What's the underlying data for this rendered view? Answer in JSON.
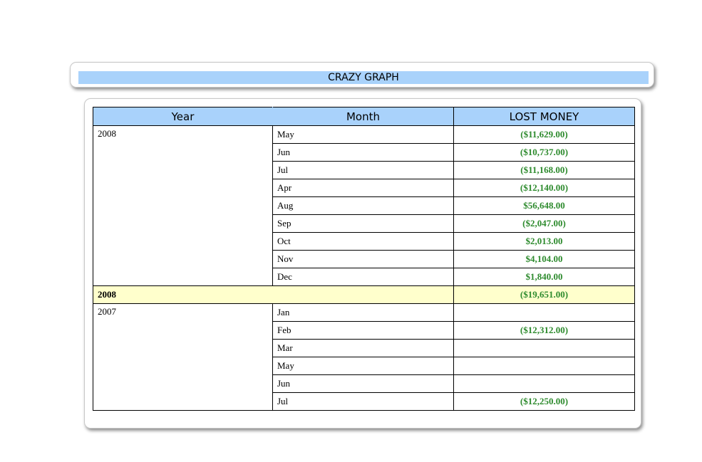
{
  "title": "CRAZY GRAPH",
  "headers": [
    "Year",
    "Month",
    "LOST MONEY"
  ],
  "groups": [
    {
      "year": "2008",
      "rows": [
        {
          "month": "May",
          "money": "($11,629.00)"
        },
        {
          "month": "Jun",
          "money": "($10,737.00)"
        },
        {
          "month": "Jul",
          "money": "($11,168.00)"
        },
        {
          "month": "Apr",
          "money": "($12,140.00)"
        },
        {
          "month": "Aug",
          "money": "$56,648.00"
        },
        {
          "month": "Sep",
          "money": "($2,047.00)"
        },
        {
          "month": "Oct",
          "money": "$2,013.00"
        },
        {
          "month": "Nov",
          "money": "$4,104.00"
        },
        {
          "month": "Dec",
          "money": "$1,840.00"
        }
      ],
      "total": {
        "label": "2008",
        "money": "($19,651.00)"
      }
    },
    {
      "year": "2007",
      "rows": [
        {
          "month": "Jan",
          "money": ""
        },
        {
          "month": "Feb",
          "money": "($12,312.00)"
        },
        {
          "month": "Mar",
          "money": ""
        },
        {
          "month": "May",
          "money": ""
        },
        {
          "month": "Jun",
          "money": ""
        },
        {
          "month": "Jul",
          "money": "($12,250.00)"
        }
      ]
    }
  ],
  "colors": {
    "header_bg": "#a9d2fb",
    "total_bg": "#ffffcc",
    "money_text": "#2e8b2e"
  }
}
